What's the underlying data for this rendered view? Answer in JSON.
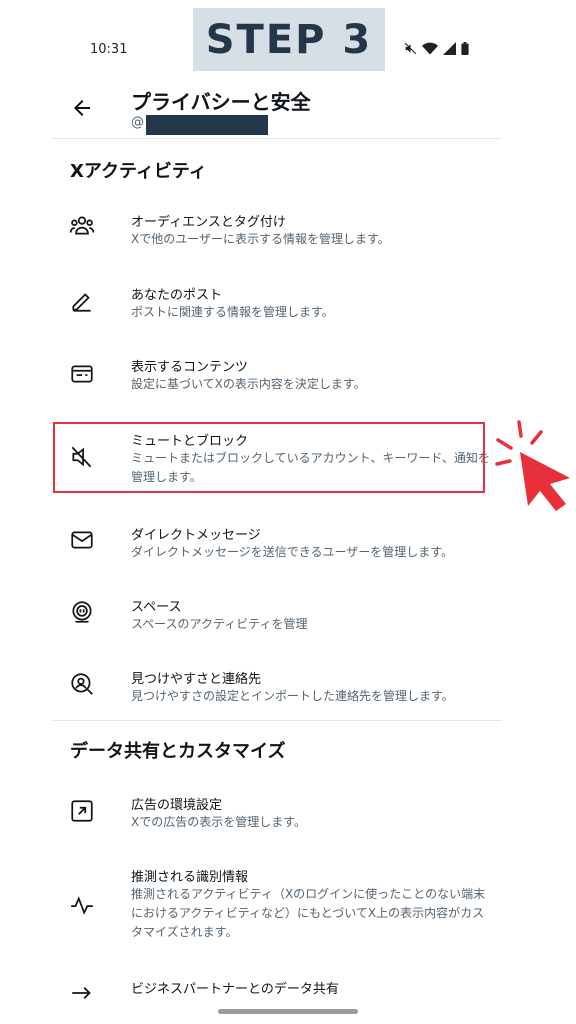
{
  "status_bar": {
    "time": "10:31"
  },
  "banner": {
    "text": "STEP 3"
  },
  "header": {
    "title": "プライバシーと安全",
    "handle_prefix": "@"
  },
  "sections": [
    {
      "title": "Xアクティビティ",
      "items": [
        {
          "icon": "people-icon",
          "title": "オーディエンスとタグ付け",
          "desc": "Xで他のユーザーに表示する情報を管理します。"
        },
        {
          "icon": "edit-icon",
          "title": "あなたのポスト",
          "desc": "ポストに関連する情報を管理します。"
        },
        {
          "icon": "content-icon",
          "title": "表示するコンテンツ",
          "desc": "設定に基づいてXの表示内容を決定します。"
        },
        {
          "icon": "mute-icon",
          "title": "ミュートとブロック",
          "desc": "ミュートまたはブロックしているアカウント、キーワード、通知を管理します。"
        },
        {
          "icon": "mail-icon",
          "title": "ダイレクトメッセージ",
          "desc": "ダイレクトメッセージを送信できるユーザーを管理します。"
        },
        {
          "icon": "spaces-icon",
          "title": "スペース",
          "desc": "スペースのアクティビティを管理"
        },
        {
          "icon": "discover-icon",
          "title": "見つけやすさと連絡先",
          "desc": "見つけやすさの設定とインポートした連絡先を管理します。"
        }
      ]
    },
    {
      "title": "データ共有とカスタマイズ",
      "items": [
        {
          "icon": "ad-icon",
          "title": "広告の環境設定",
          "desc": "Xでの広告の表示を管理します。"
        },
        {
          "icon": "activity-icon",
          "title": "推測される識別情報",
          "desc": "推測されるアクティビティ（Xのログインに使ったことのない端末におけるアクティビティなど）にもとづいてX上の表示内容がカスタマイズされます。"
        },
        {
          "icon": "share-icon",
          "title": "ビジネスパートナーとのデータ共有",
          "desc": ""
        }
      ]
    }
  ],
  "colors": {
    "highlight": "#e8303a",
    "banner_bg": "#d7dfe6",
    "banner_text": "#24364a",
    "subtext": "#536471"
  }
}
